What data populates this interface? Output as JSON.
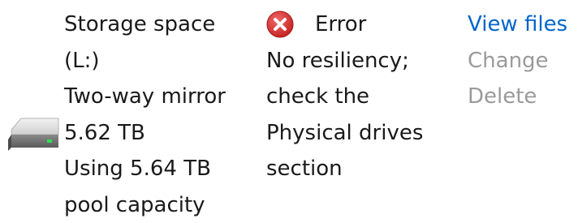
{
  "space": {
    "name_line1": "Storage space",
    "name_line2": "(L:)",
    "type": "Two-way mirror",
    "size": "5.62 TB",
    "usage_line1": "Using 5.64 TB",
    "usage_line2": "pool capacity",
    "icon": "hard-drive-icon"
  },
  "status": {
    "icon": "error-icon",
    "label": "Error",
    "message_lines": [
      "No resiliency;",
      "check the",
      "Physical drives",
      "section"
    ]
  },
  "actions": {
    "view_files": "View files",
    "change": "Change",
    "delete": "Delete"
  },
  "colors": {
    "link": "#0066cc",
    "disabled": "#9a9a9a",
    "error": "#d92b2b"
  }
}
